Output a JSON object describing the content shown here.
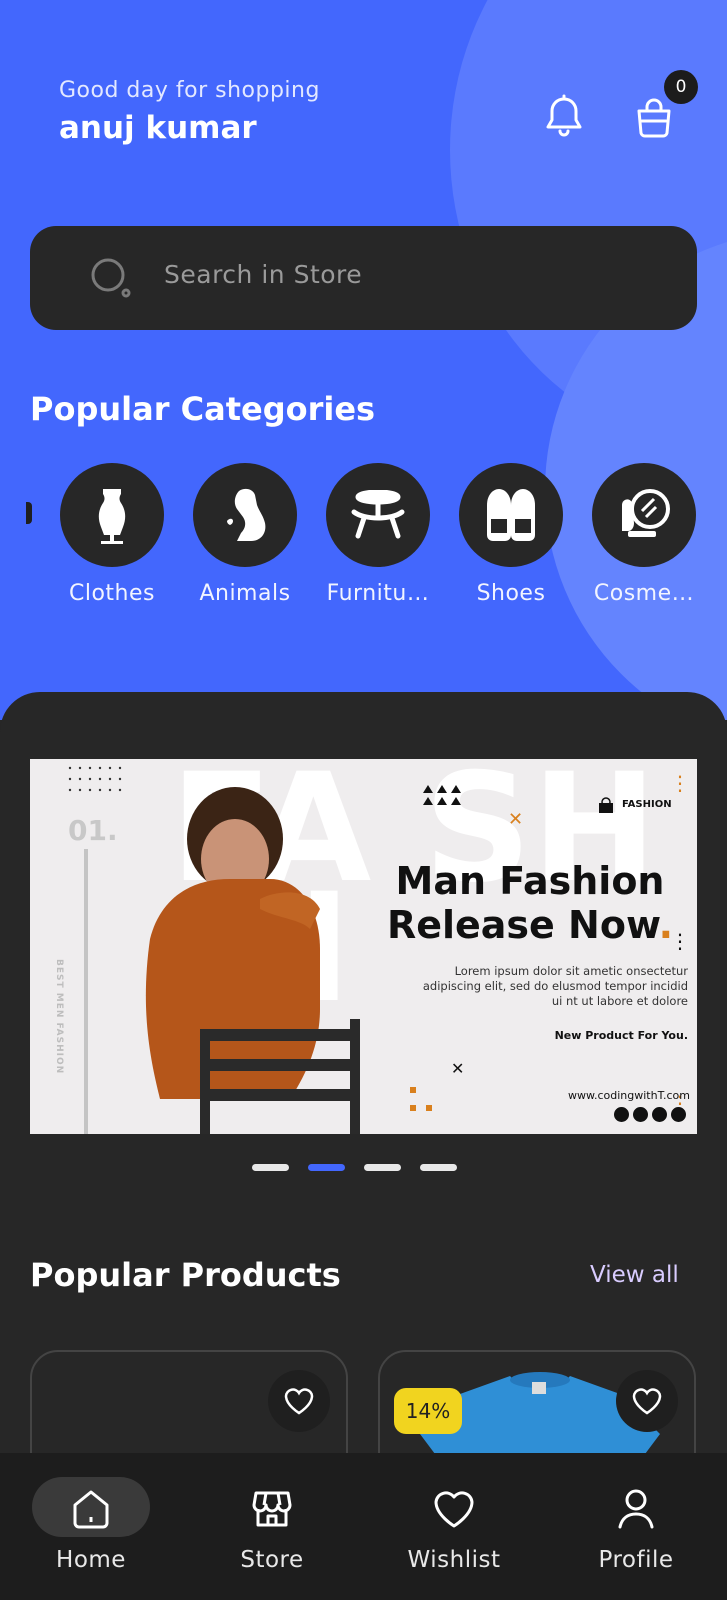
{
  "header": {
    "greeting": "Good day for shopping",
    "username": "anuj kumar",
    "cart_count": "0"
  },
  "search": {
    "placeholder": "Search in Store"
  },
  "categories": {
    "title": "Popular Categories",
    "items": [
      {
        "label": "Clothes",
        "icon": "mannequin-icon"
      },
      {
        "label": "Animals",
        "icon": "dog-icon"
      },
      {
        "label": "Furnitu…",
        "icon": "table-icon"
      },
      {
        "label": "Shoes",
        "icon": "slippers-icon"
      },
      {
        "label": "Cosme…",
        "icon": "mirror-icon"
      }
    ]
  },
  "banner": {
    "number": "01.",
    "vertical_text": "BEST MEN FASHION",
    "brand": "FASHION",
    "heading_line1": "Man Fashion",
    "heading_line2": "Release Now",
    "heading_dot": ".",
    "lorem": "Lorem ipsum dolor sit ametic onsectetur adipiscing elit, sed do elusmod tempor incidid ui nt ut labore et dolore",
    "new_product": "New Product For You.",
    "url": "www.codingwithT.com",
    "bg_text": "FA SH IN",
    "slide_count": 4,
    "active_slide": 1
  },
  "products": {
    "title": "Popular Products",
    "view_all": "View all",
    "items": [
      {
        "discount": ""
      },
      {
        "discount": "14%"
      }
    ]
  },
  "nav": {
    "items": [
      {
        "label": "Home",
        "icon": "home-icon",
        "active": true
      },
      {
        "label": "Store",
        "icon": "store-icon",
        "active": false
      },
      {
        "label": "Wishlist",
        "icon": "heart-icon",
        "active": false
      },
      {
        "label": "Profile",
        "icon": "user-icon",
        "active": false
      }
    ]
  },
  "colors": {
    "primary": "#4367fd",
    "dark": "#272727",
    "accent_orange": "#d9801d",
    "badge_yellow": "#f1d41f"
  }
}
